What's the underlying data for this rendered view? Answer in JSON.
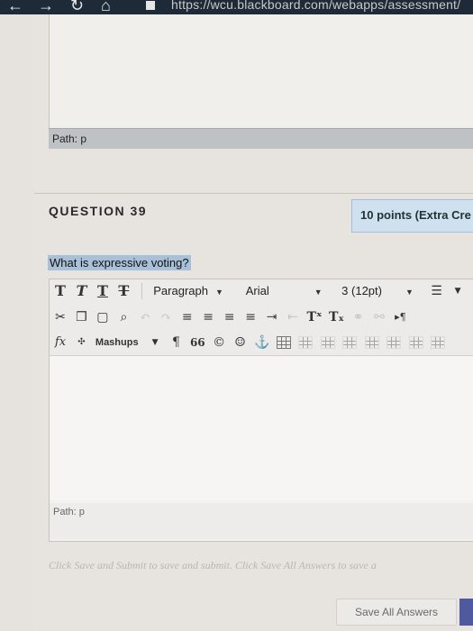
{
  "browser": {
    "url": "https://wcu.blackboard.com/webapps/assessment/"
  },
  "previous_editor": {
    "path_label": "Path: p"
  },
  "question": {
    "title": "QUESTION 39",
    "points": "10 points (Extra Cre",
    "prompt": "What is expressive voting?"
  },
  "toolbar": {
    "format_select": "Paragraph",
    "font_select": "Arial",
    "size_select": "3 (12pt)",
    "mashups_label": "Mashups",
    "pilcrow": "¶",
    "quote": "66",
    "copyright": "©",
    "smiley": "☺",
    "anchor": "⚓",
    "function": "fx"
  },
  "editor": {
    "path_label": "Path: p"
  },
  "footer": {
    "note": "Click Save and Submit to save and submit. Click Save All Answers to save a",
    "save_all_label": "Save All Answers"
  }
}
